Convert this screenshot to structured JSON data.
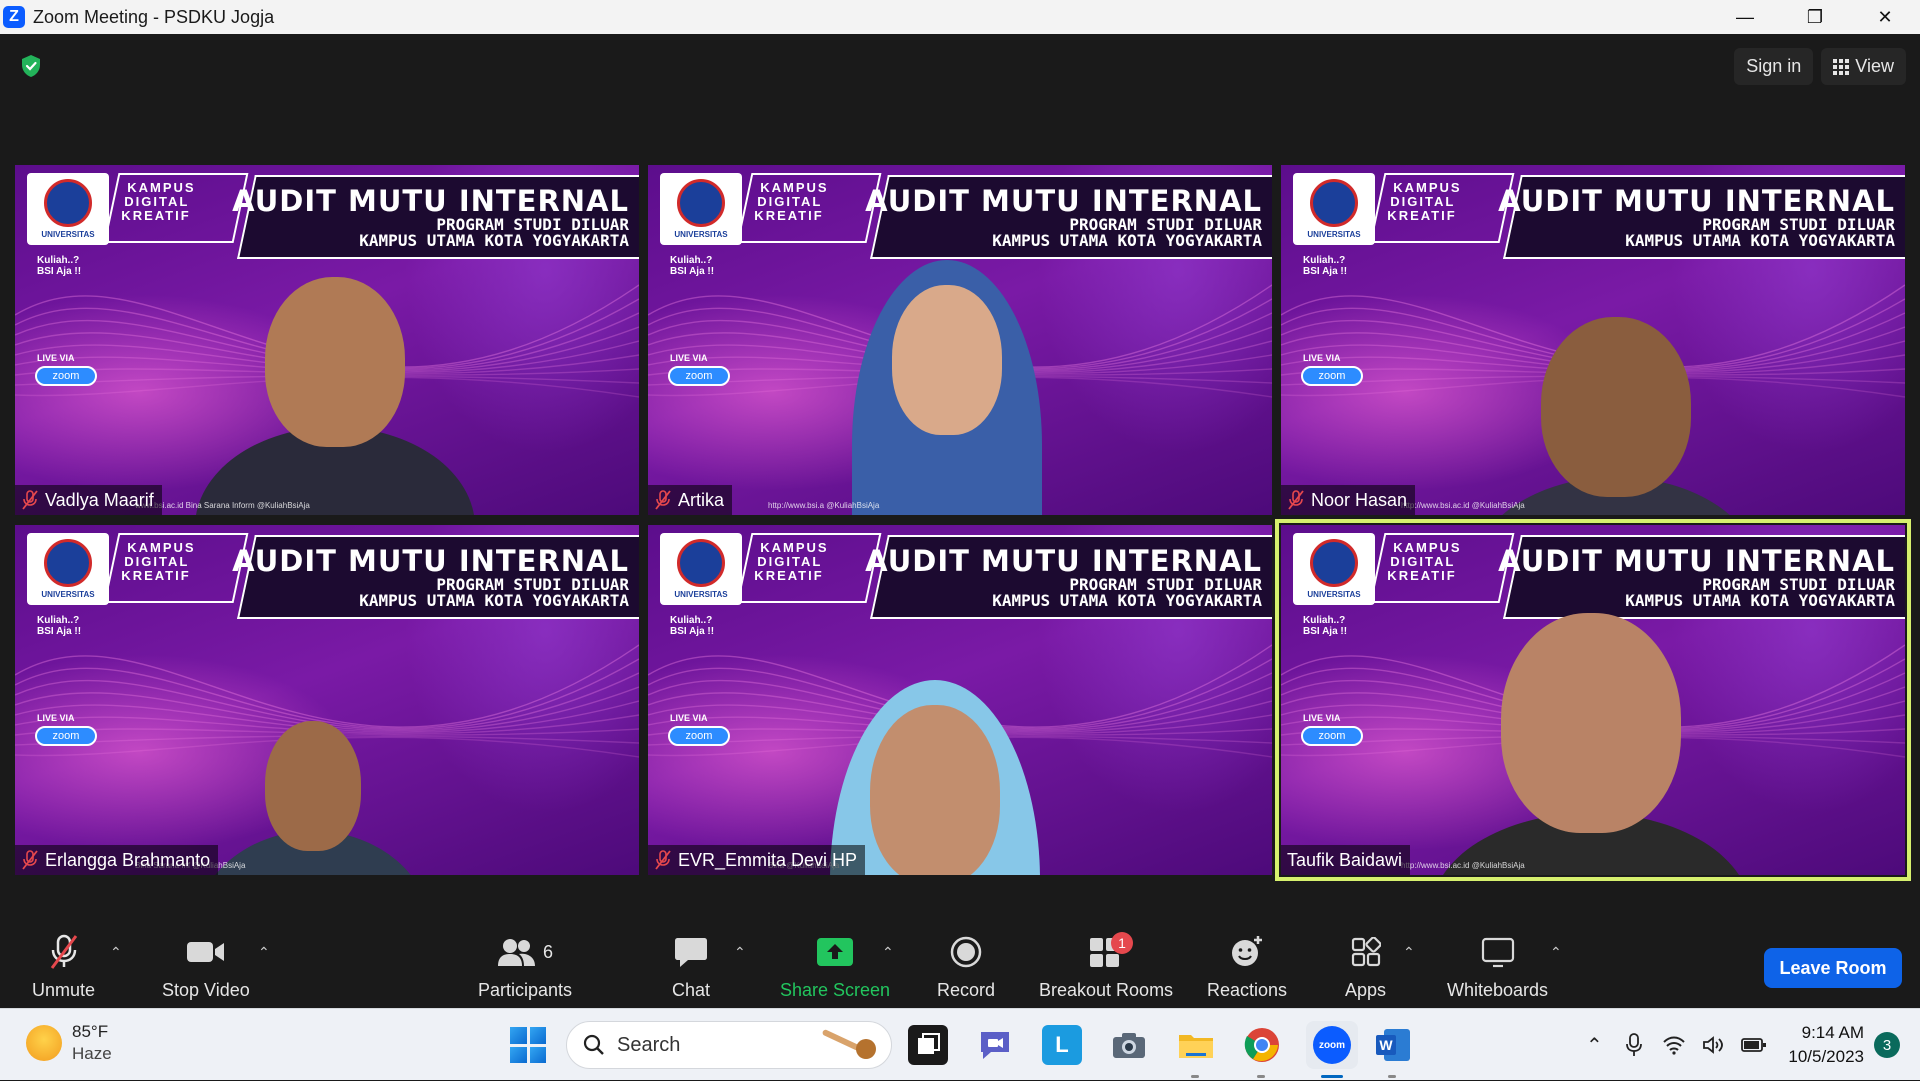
{
  "window": {
    "title": "Zoom Meeting - PSDKU Jogja",
    "app_icon": "Z"
  },
  "topbar": {
    "sign_in": "Sign in",
    "view": "View"
  },
  "background": {
    "logo_label": "UNIVERSITAS",
    "kdk": [
      "KAMPUS",
      "DIGITAL",
      "KREATIF"
    ],
    "title": "AUDIT MUTU INTERNAL",
    "subtitle1": "PROGRAM STUDI DILUAR",
    "subtitle2": "KAMPUS UTAMA KOTA YOGYAKARTA",
    "tagline": [
      "Kuliah..?",
      "BSI Aja !!"
    ],
    "live_via": "LIVE VIA",
    "zoom": "zoom"
  },
  "participants": [
    {
      "name": "Vadlya Maarif",
      "muted": true,
      "footer": "www.bsi.ac.id   Bina Sarana Inform   @KuliahBsiAja"
    },
    {
      "name": "Artika",
      "muted": true,
      "footer": "http://www.bsi.a   @KuliahBsiAja"
    },
    {
      "name": "Noor Hasan",
      "muted": true,
      "footer": "http://www.bsi.ac.id   @KuliahBsiAja"
    },
    {
      "name": "Erlangga Brahmanto",
      "muted": true,
      "footer": "Bina Sarana Inf   @KuliahBsiAja"
    },
    {
      "name": "EVR_Emmita Devi HP",
      "muted": true,
      "footer": "Bina   @KuliahBsiAja"
    },
    {
      "name": "Taufik Baidawi",
      "muted": false,
      "footer": "http://www.bsi.ac.id   @KuliahBsiAja"
    }
  ],
  "toolbar": {
    "unmute": "Unmute",
    "stop_video": "Stop Video",
    "participants": "Participants",
    "participants_count": "6",
    "chat": "Chat",
    "share_screen": "Share Screen",
    "record": "Record",
    "breakout_rooms": "Breakout Rooms",
    "breakout_badge": "1",
    "reactions": "Reactions",
    "apps": "Apps",
    "whiteboards": "Whiteboards",
    "leave_room": "Leave Room"
  },
  "taskbar": {
    "temperature": "85°F",
    "condition": "Haze",
    "search_placeholder": "Search",
    "time": "9:14 AM",
    "date": "10/5/2023",
    "notifications": "3"
  },
  "colors": {
    "active_speaker_border": "#d6f06e",
    "share_green": "#22c55e",
    "leave_blue": "#0e63e8",
    "zoom_blue": "#0b5cff"
  }
}
